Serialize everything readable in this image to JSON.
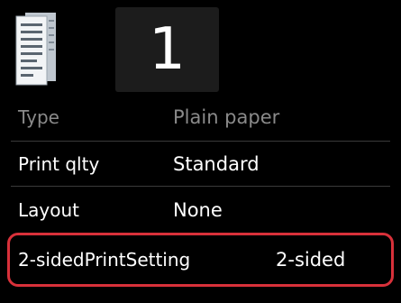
{
  "header": {
    "copies": "1"
  },
  "icons": {
    "document": "document-preview-icon"
  },
  "settings": [
    {
      "label": "Type",
      "value": "Plain paper",
      "enabled": false
    },
    {
      "label": "Print qlty",
      "value": "Standard",
      "enabled": true
    },
    {
      "label": "Layout",
      "value": "None",
      "enabled": true
    },
    {
      "label": "2-sidedPrintSetting",
      "value": "2-sided",
      "enabled": true,
      "selected": true
    }
  ],
  "colors": {
    "background": "#000000",
    "highlight_border": "#d8313a",
    "disabled_text": "#8a8a8a"
  }
}
